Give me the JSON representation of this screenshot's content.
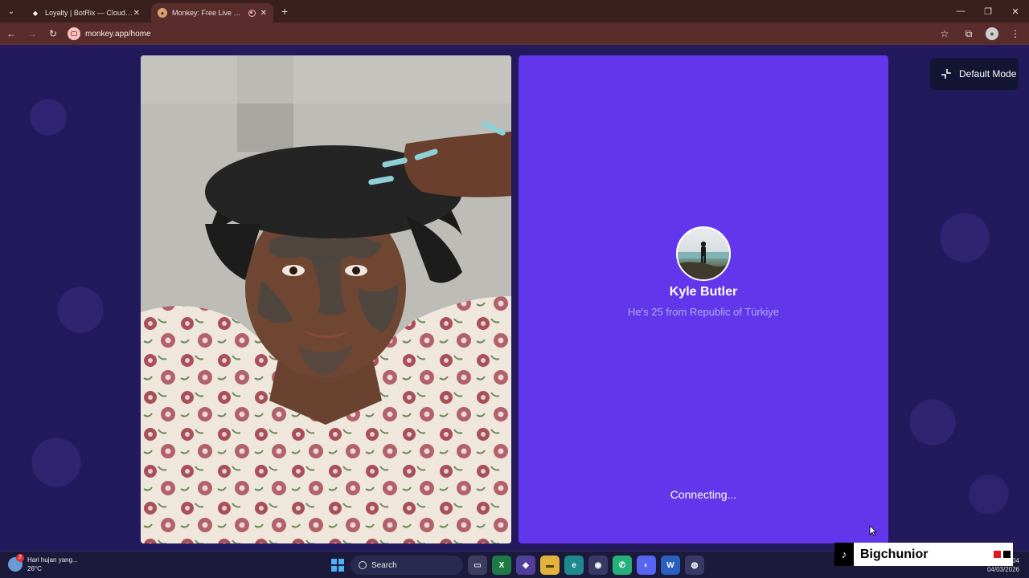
{
  "browser": {
    "tabs": [
      {
        "title": "Loyalty | BotRix — Cloud Stream",
        "active": false
      },
      {
        "title": "Monkey: Free Live Video Ch",
        "active": true
      }
    ],
    "url": "monkey.app/home"
  },
  "page": {
    "mode_button_label": "Default Mode",
    "match": {
      "name": "Kyle Butler",
      "subtitle": "He's 25 from Republic of Türkiye"
    },
    "status": "Connecting..."
  },
  "taskbar": {
    "weather_text": "Hari hujan yang...",
    "weather_temp": "26°C",
    "weather_badge": "2",
    "search_label": "Search",
    "date": "04/03/2026",
    "time": "04"
  },
  "watermark": {
    "handle": "Bigchunior"
  },
  "colors": {
    "page_bg": "#231a5e",
    "panel_bg": "#6237ec",
    "chrome_bg": "#5a2d2d"
  }
}
